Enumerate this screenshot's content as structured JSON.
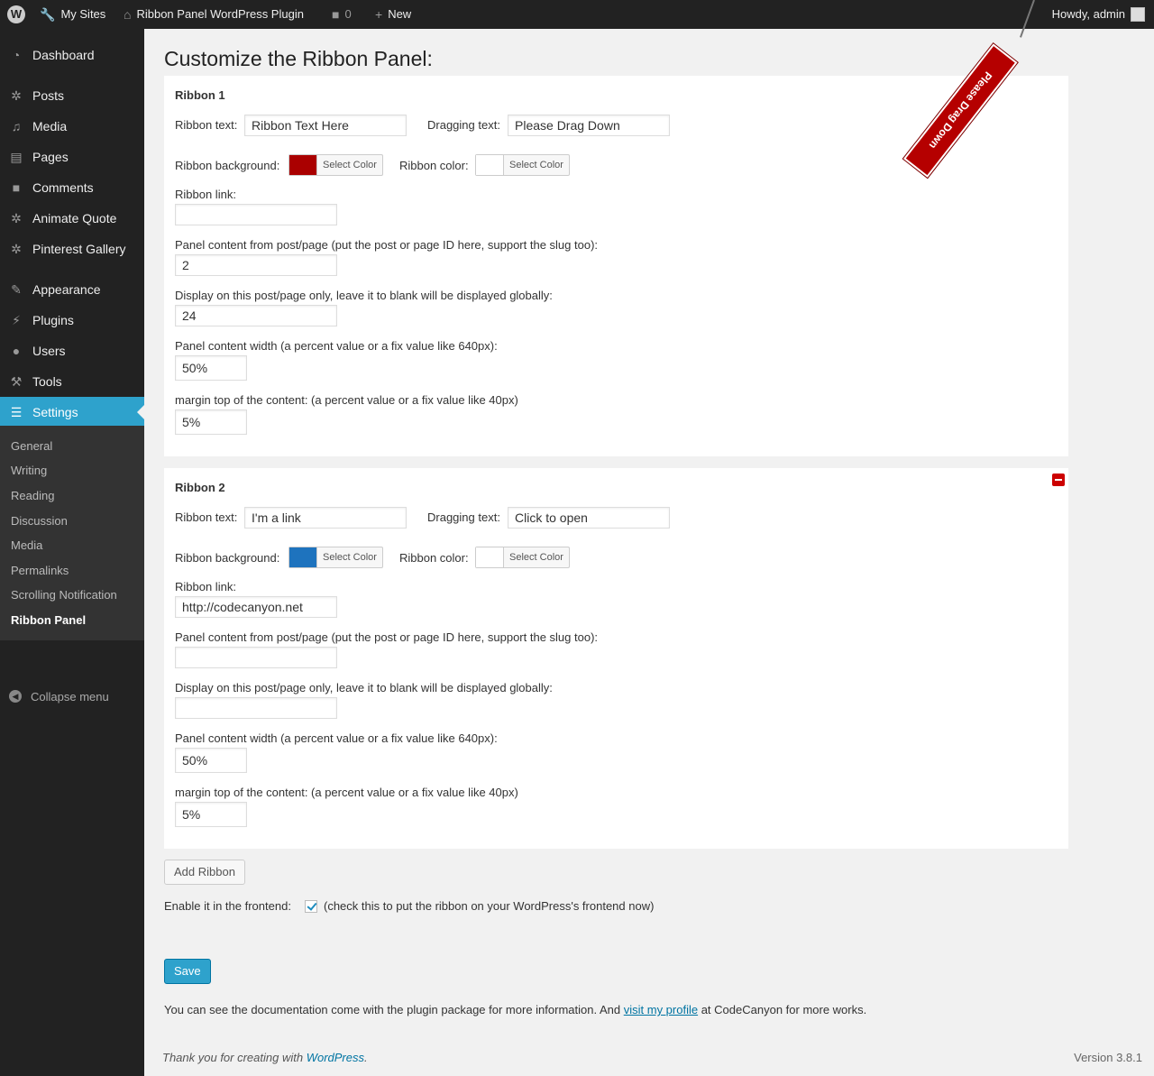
{
  "adminbar": {
    "wp_logo": "W",
    "my_sites": "My Sites",
    "site_name": "Ribbon Panel WordPress Plugin",
    "comments_count": "0",
    "new_label": "New",
    "howdy": "Howdy, admin"
  },
  "sidebar": {
    "dashboard": "Dashboard",
    "posts": "Posts",
    "media": "Media",
    "pages": "Pages",
    "comments": "Comments",
    "animate_quote": "Animate Quote",
    "pinterest_gallery": "Pinterest Gallery",
    "appearance": "Appearance",
    "plugins": "Plugins",
    "users": "Users",
    "tools": "Tools",
    "settings": "Settings",
    "submenu": [
      "General",
      "Writing",
      "Reading",
      "Discussion",
      "Media",
      "Permalinks",
      "Scrolling Notification",
      "Ribbon Panel"
    ],
    "collapse": "Collapse menu"
  },
  "page": {
    "title": "Customize the Ribbon Panel:"
  },
  "labels": {
    "ribbon_text": "Ribbon text:",
    "dragging_text": "Dragging text:",
    "ribbon_background": "Ribbon background:",
    "ribbon_color": "Ribbon color:",
    "select_color": "Select Color",
    "ribbon_link": "Ribbon link:",
    "panel_content": "Panel content from post/page (put the post or page ID here, support the slug too):",
    "display_on": "Display on this post/page only, leave it to blank will be displayed globally:",
    "panel_width": "Panel content width (a percent value or a fix value like 640px):",
    "margin_top": "margin top of the content: (a percent value or a fix value like 40px)"
  },
  "ribbons": [
    {
      "title": "Ribbon 1",
      "ribbon_text": "Ribbon Text Here",
      "dragging_text": "Please Drag Down",
      "background_color": "#aa0000",
      "ribbon_color": "#ffffff",
      "link": "",
      "panel_content": "2",
      "display_on": "24",
      "width": "50%",
      "margin_top": "5%"
    },
    {
      "title": "Ribbon 2",
      "ribbon_text": "I'm a link",
      "dragging_text": "Click to open",
      "background_color": "#1e73be",
      "ribbon_color": "#ffffff",
      "link": "http://codecanyon.net",
      "panel_content": "",
      "display_on": "",
      "width": "50%",
      "margin_top": "5%"
    }
  ],
  "actions": {
    "add_ribbon": "Add Ribbon",
    "enable_label": "Enable it in the frontend:",
    "enable_hint": "(check this to put the ribbon on your WordPress's frontend now)",
    "save": "Save"
  },
  "info": {
    "prefix": "You can see the documentation come with the plugin package for more information. And ",
    "link_text": "visit my profile",
    "suffix": " at CodeCanyon for more works."
  },
  "footer": {
    "thanks_prefix": "Thank you for creating with ",
    "wordpress": "WordPress",
    "thanks_suffix": ".",
    "version": "Version 3.8.1"
  },
  "ribbon_preview": {
    "text": "Please Drag Down"
  }
}
